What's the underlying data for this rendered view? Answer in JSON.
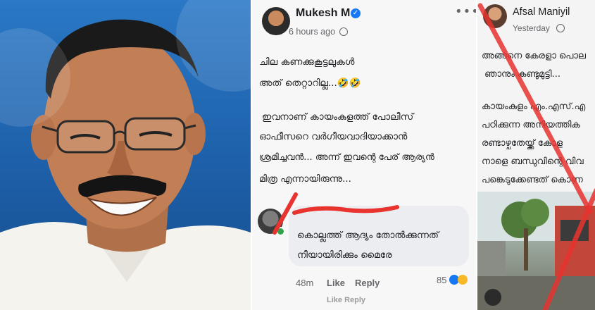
{
  "post": {
    "author": "Mukesh M",
    "time": "6 hours ago",
    "more_glyph": "•••",
    "lines": [
      "ചില കണക്കുകൂട്ടലുകൾ",
      "അത് തെറ്റാറില്ല...🤣🤣",
      "ഇവനാണ് കായംകുളത്ത് പോലീസ്",
      "ഓഫീസറെ വർഗീയവാദിയാക്കാൻ",
      "ശ്രമിച്ചവൻ... അന്ന് ഇവന്റെ പേര് ആര്യൻ",
      "മിത്ര എന്നായിരുന്നു..."
    ]
  },
  "comment": {
    "lines": [
      "കൊല്ലത്ത് ആദ്യം തോൽക്കുന്നത്",
      "നീയായിരിക്കും മൈരേ"
    ],
    "time": "48m",
    "like": "Like",
    "reply": "Reply",
    "reaction_count": "85",
    "below": "Like   Reply"
  },
  "post2": {
    "author": "Afsal Maniyil",
    "time": "Yesterday",
    "lines": [
      "അങ്ങനെ കേരളാ പൊല",
      "ഞാനും കണ്ടുമുട്ടി...",
      "കായംകുളം എം.എസ്.എ",
      "പഠിക്കുന്ന അനിയത്തിക",
      "രണ്ടാഴ്ചതേയ്ക്ക് കോള",
      "നാളെ ബന്ധുവിന്റെ വിവ",
      "പങ്കെടുക്കേണ്ടത് കൊണ"
    ]
  },
  "colors": {
    "facebook_blue": "#1877f2",
    "red_annotation": "#e8332f",
    "online_green": "#31a24c"
  }
}
